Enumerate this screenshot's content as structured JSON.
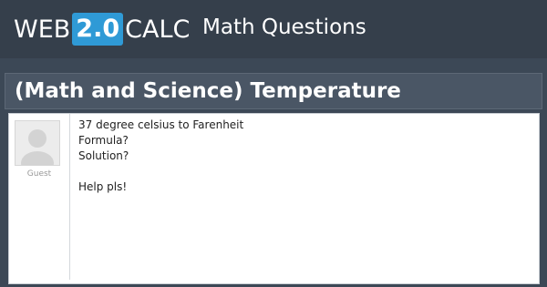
{
  "header": {
    "logo_left": "WEB",
    "logo_badge": "2.0",
    "logo_right": "CALC",
    "section": "Math Questions"
  },
  "question": {
    "title": "(Math and Science) Temperature",
    "author": "Guest",
    "lines": [
      "37 degree celsius to Farenheit",
      "Formula?",
      "Solution?",
      "Help pls!"
    ]
  }
}
